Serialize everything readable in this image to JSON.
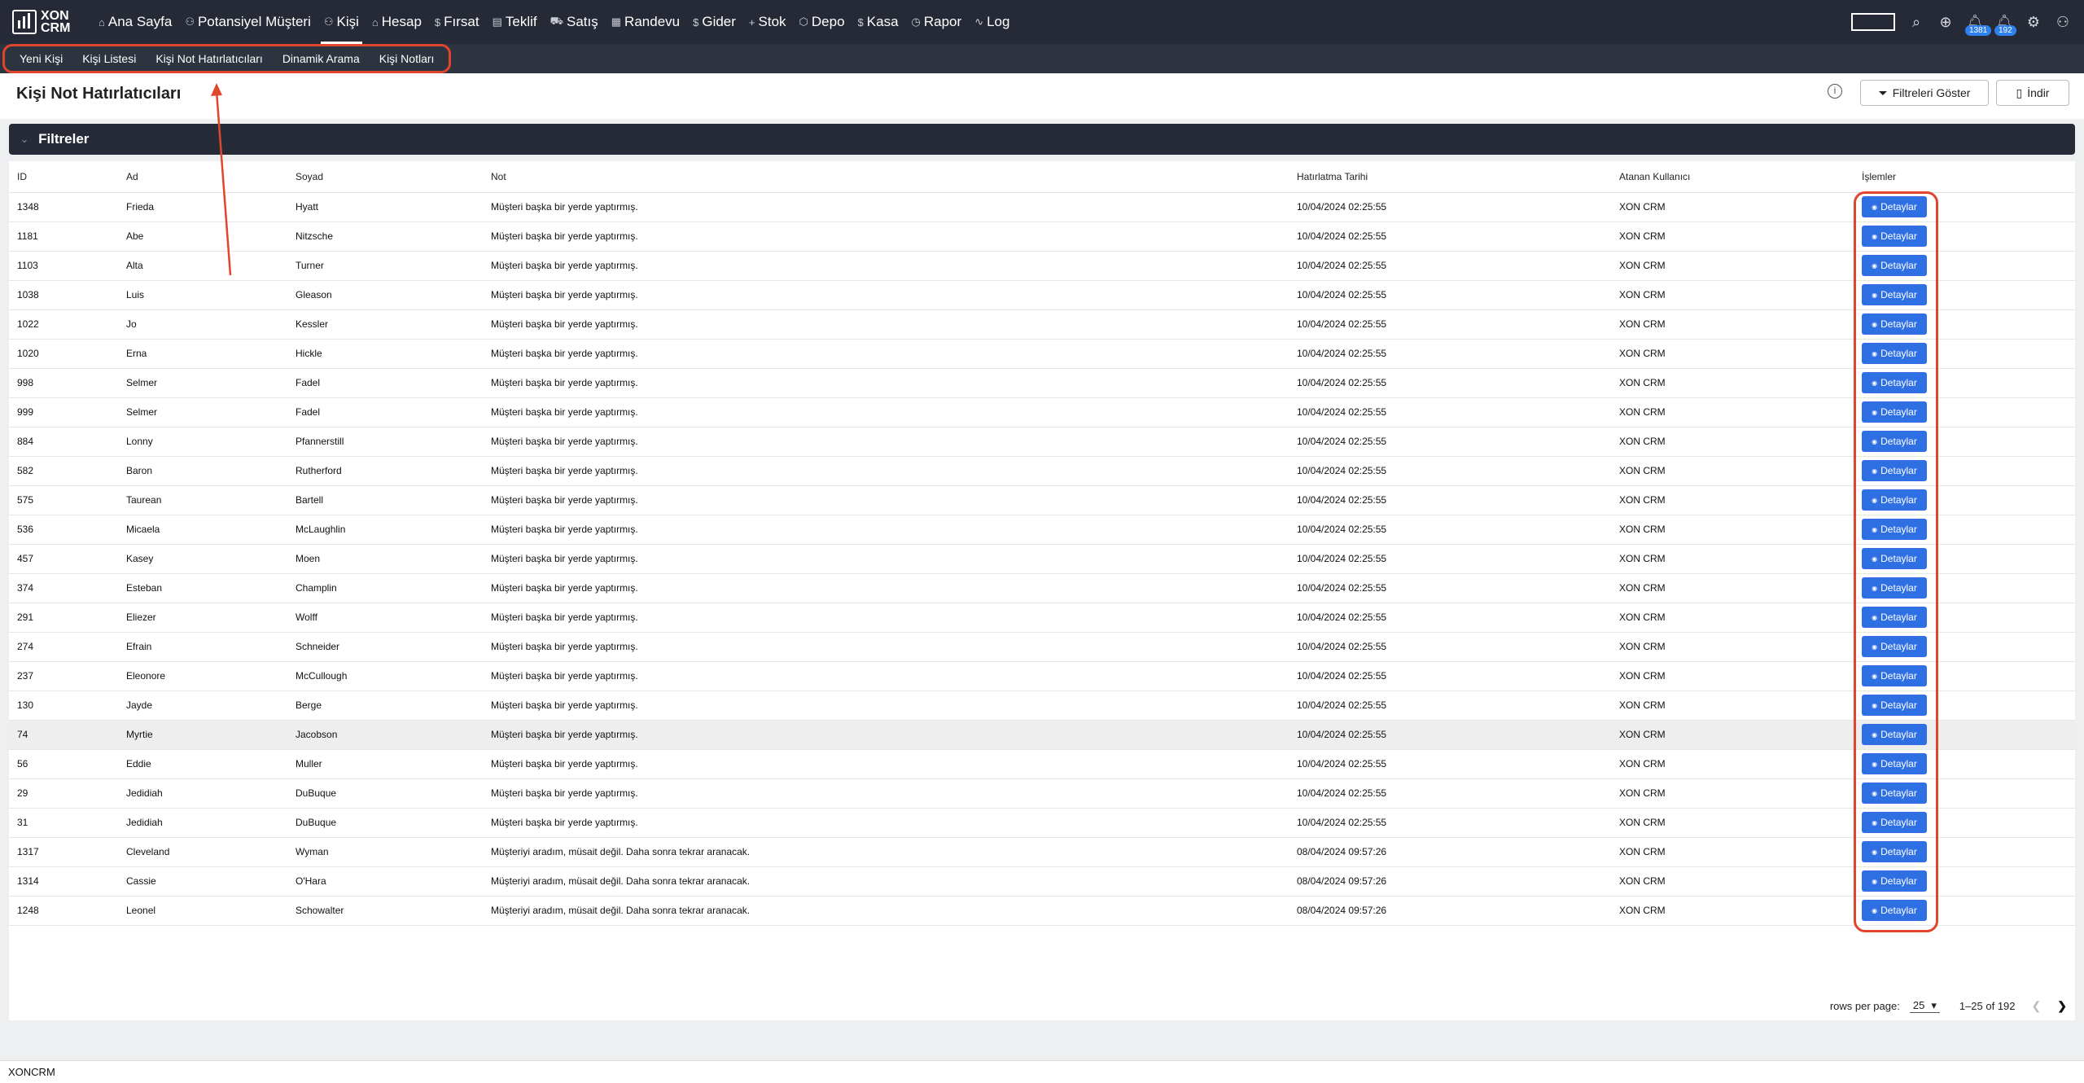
{
  "app": {
    "logo_line1": "XON",
    "logo_line2": "CRM"
  },
  "nav": [
    {
      "label": "Ana Sayfa",
      "icon": "home-icon",
      "glyph": "⌂"
    },
    {
      "label": "Potansiyel Müşteri",
      "icon": "person-icon",
      "glyph": "⚇"
    },
    {
      "label": "Kişi",
      "icon": "people-icon",
      "glyph": "⚇"
    },
    {
      "label": "Hesap",
      "icon": "home-icon",
      "glyph": "⌂"
    },
    {
      "label": "Fırsat",
      "icon": "dollar-icon",
      "glyph": "$"
    },
    {
      "label": "Teklif",
      "icon": "document-icon",
      "glyph": "▤"
    },
    {
      "label": "Satış",
      "icon": "cart-icon",
      "glyph": "⛟"
    },
    {
      "label": "Randevu",
      "icon": "calendar-icon",
      "glyph": "▦"
    },
    {
      "label": "Gider",
      "icon": "dollar-icon",
      "glyph": "$"
    },
    {
      "label": "Stok",
      "icon": "plus-icon",
      "glyph": "+"
    },
    {
      "label": "Depo",
      "icon": "warehouse-icon",
      "glyph": "⬡"
    },
    {
      "label": "Kasa",
      "icon": "dollar-icon",
      "glyph": "$"
    },
    {
      "label": "Rapor",
      "icon": "clock-icon",
      "glyph": "◷"
    },
    {
      "label": "Log",
      "icon": "activity-icon",
      "glyph": "∿"
    }
  ],
  "active_nav": "Kişi",
  "topbar_right": {
    "notifications_count": "1381",
    "messages_count": "192"
  },
  "subnav": [
    "Yeni Kişi",
    "Kişi Listesi",
    "Kişi Not Hatırlatıcıları",
    "Dinamik Arama",
    "Kişi Notları"
  ],
  "page": {
    "title": "Kişi Not Hatırlatıcıları",
    "show_filters_label": "Filtreleri Göster",
    "download_label": "İndir",
    "filters_title": "Filtreler"
  },
  "table": {
    "columns": [
      "ID",
      "Ad",
      "Soyad",
      "Not",
      "Hatırlatma Tarihi",
      "Atanan Kullanıcı",
      "İşlemler"
    ],
    "action_label": "Detaylar",
    "rows": [
      [
        "1348",
        "Frieda",
        "Hyatt",
        "Müşteri başka bir yerde yaptırmış.",
        "10/04/2024 02:25:55",
        "XON CRM"
      ],
      [
        "1181",
        "Abe",
        "Nitzsche",
        "Müşteri başka bir yerde yaptırmış.",
        "10/04/2024 02:25:55",
        "XON CRM"
      ],
      [
        "1103",
        "Alta",
        "Turner",
        "Müşteri başka bir yerde yaptırmış.",
        "10/04/2024 02:25:55",
        "XON CRM"
      ],
      [
        "1038",
        "Luis",
        "Gleason",
        "Müşteri başka bir yerde yaptırmış.",
        "10/04/2024 02:25:55",
        "XON CRM"
      ],
      [
        "1022",
        "Jo",
        "Kessler",
        "Müşteri başka bir yerde yaptırmış.",
        "10/04/2024 02:25:55",
        "XON CRM"
      ],
      [
        "1020",
        "Erna",
        "Hickle",
        "Müşteri başka bir yerde yaptırmış.",
        "10/04/2024 02:25:55",
        "XON CRM"
      ],
      [
        "998",
        "Selmer",
        "Fadel",
        "Müşteri başka bir yerde yaptırmış.",
        "10/04/2024 02:25:55",
        "XON CRM"
      ],
      [
        "999",
        "Selmer",
        "Fadel",
        "Müşteri başka bir yerde yaptırmış.",
        "10/04/2024 02:25:55",
        "XON CRM"
      ],
      [
        "884",
        "Lonny",
        "Pfannerstill",
        "Müşteri başka bir yerde yaptırmış.",
        "10/04/2024 02:25:55",
        "XON CRM"
      ],
      [
        "582",
        "Baron",
        "Rutherford",
        "Müşteri başka bir yerde yaptırmış.",
        "10/04/2024 02:25:55",
        "XON CRM"
      ],
      [
        "575",
        "Taurean",
        "Bartell",
        "Müşteri başka bir yerde yaptırmış.",
        "10/04/2024 02:25:55",
        "XON CRM"
      ],
      [
        "536",
        "Micaela",
        "McLaughlin",
        "Müşteri başka bir yerde yaptırmış.",
        "10/04/2024 02:25:55",
        "XON CRM"
      ],
      [
        "457",
        "Kasey",
        "Moen",
        "Müşteri başka bir yerde yaptırmış.",
        "10/04/2024 02:25:55",
        "XON CRM"
      ],
      [
        "374",
        "Esteban",
        "Champlin",
        "Müşteri başka bir yerde yaptırmış.",
        "10/04/2024 02:25:55",
        "XON CRM"
      ],
      [
        "291",
        "Eliezer",
        "Wolff",
        "Müşteri başka bir yerde yaptırmış.",
        "10/04/2024 02:25:55",
        "XON CRM"
      ],
      [
        "274",
        "Efrain",
        "Schneider",
        "Müşteri başka bir yerde yaptırmış.",
        "10/04/2024 02:25:55",
        "XON CRM"
      ],
      [
        "237",
        "Eleonore",
        "McCullough",
        "Müşteri başka bir yerde yaptırmış.",
        "10/04/2024 02:25:55",
        "XON CRM"
      ],
      [
        "130",
        "Jayde",
        "Berge",
        "Müşteri başka bir yerde yaptırmış.",
        "10/04/2024 02:25:55",
        "XON CRM"
      ],
      [
        "74",
        "Myrtie",
        "Jacobson",
        "Müşteri başka bir yerde yaptırmış.",
        "10/04/2024 02:25:55",
        "XON CRM"
      ],
      [
        "56",
        "Eddie",
        "Muller",
        "Müşteri başka bir yerde yaptırmış.",
        "10/04/2024 02:25:55",
        "XON CRM"
      ],
      [
        "29",
        "Jedidiah",
        "DuBuque",
        "Müşteri başka bir yerde yaptırmış.",
        "10/04/2024 02:25:55",
        "XON CRM"
      ],
      [
        "31",
        "Jedidiah",
        "DuBuque",
        "Müşteri başka bir yerde yaptırmış.",
        "10/04/2024 02:25:55",
        "XON CRM"
      ],
      [
        "1317",
        "Cleveland",
        "Wyman",
        "Müşteriyi aradım, müsait değil. Daha sonra tekrar aranacak.",
        "08/04/2024 09:57:26",
        "XON CRM"
      ],
      [
        "1314",
        "Cassie",
        "O'Hara",
        "Müşteriyi aradım, müsait değil. Daha sonra tekrar aranacak.",
        "08/04/2024 09:57:26",
        "XON CRM"
      ],
      [
        "1248",
        "Leonel",
        "Schowalter",
        "Müşteriyi aradım, müsait değil. Daha sonra tekrar aranacak.",
        "08/04/2024 09:57:26",
        "XON CRM"
      ]
    ],
    "highlighted_row_index": 18
  },
  "pagination": {
    "rows_per_page_label": "rows per page:",
    "rows_per_page_value": "25",
    "range_label": "1–25 of 192"
  },
  "footer": {
    "text": "XONCRM"
  },
  "colors": {
    "topbar_bg": "#252a36",
    "subbar_bg": "#2e3340",
    "accent_blue": "#2f6fe4",
    "annotation_red": "#e0462b"
  }
}
